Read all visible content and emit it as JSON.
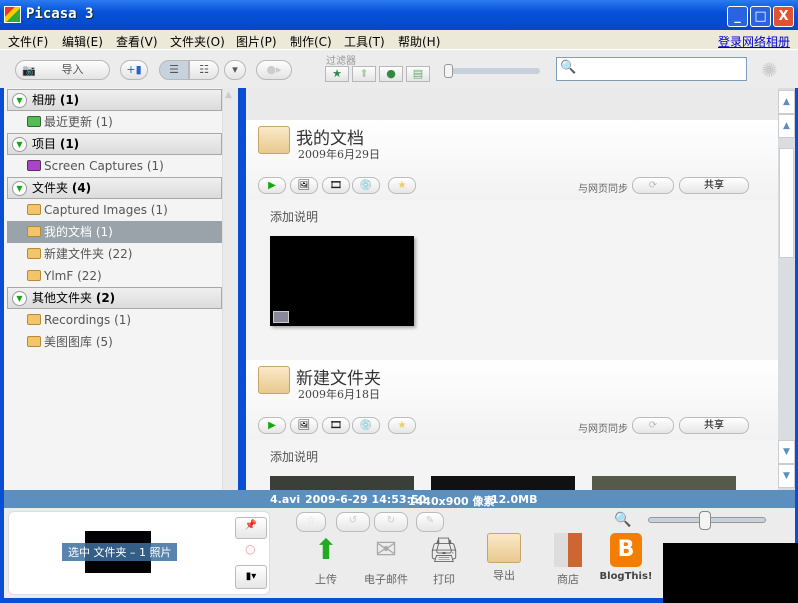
{
  "window": {
    "title": "Picasa 3",
    "minimize": "_",
    "maximize": "□",
    "close": "X"
  },
  "menu": [
    "文件(F)",
    "编辑(E)",
    "查看(V)",
    "文件夹(O)",
    "图片(P)",
    "制作(C)",
    "工具(T)",
    "帮助(H)"
  ],
  "login_link": "登录网络相册",
  "toolbar": {
    "import_label": "导入",
    "filter_label": "过滤器",
    "search_placeholder": ""
  },
  "sidebar": {
    "sections": [
      {
        "label": "相册",
        "count": "(1)",
        "items": [
          {
            "label": "最近更新 (1)",
            "icon": "album-green-icon"
          }
        ]
      },
      {
        "label": "项目",
        "count": "(1)",
        "items": [
          {
            "label": "Screen Captures (1)",
            "icon": "album-purple-icon"
          }
        ]
      },
      {
        "label": "文件夹",
        "count": "(4)",
        "items": [
          {
            "label": "Captured Images (1)"
          },
          {
            "label": "我的文档 (1)",
            "selected": true
          },
          {
            "label": "新建文件夹 (22)"
          },
          {
            "label": "YlmF (22)"
          }
        ]
      },
      {
        "label": "其他文件夹",
        "count": "(2)",
        "items": [
          {
            "label": "Recordings (1)"
          },
          {
            "label": "美图图库 (5)"
          }
        ]
      }
    ]
  },
  "albums": [
    {
      "name": "我的文档",
      "date": "2009年6月29日",
      "sync_label": "与网页同步",
      "share_label": "共享",
      "caption": "添加说明"
    },
    {
      "name": "新建文件夹",
      "date": "2009年6月18日",
      "sync_label": "与网页同步",
      "share_label": "共享",
      "caption": "添加说明"
    }
  ],
  "status": {
    "file": "4.avi",
    "datetime": "2009-6-29 14:53:50",
    "resolution": "1440x900 像素",
    "size": "12.0MB"
  },
  "tray": {
    "selection_label": "选中 文件夹 – 1 照片"
  },
  "actions": [
    {
      "label": "上传"
    },
    {
      "label": "电子邮件"
    },
    {
      "label": "打印"
    },
    {
      "label": "导出"
    },
    {
      "label": "商店"
    },
    {
      "label": "BlogThis!"
    }
  ],
  "colors": {
    "titlebar": "#0752d8",
    "status": "#5a8fbf",
    "selected": "#99a3a9"
  }
}
